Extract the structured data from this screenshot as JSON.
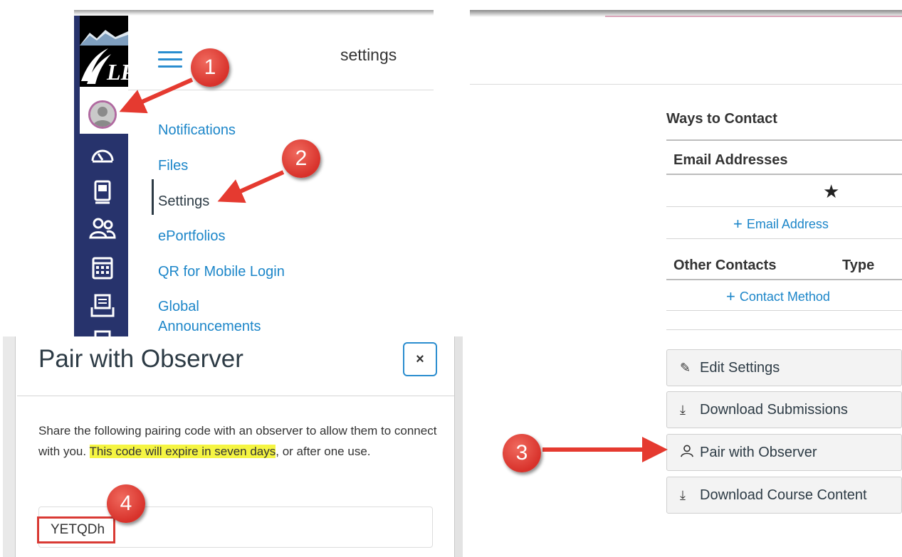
{
  "account_menu": {
    "title": "settings",
    "links": [
      {
        "label": "Notifications"
      },
      {
        "label": "Files"
      },
      {
        "label": "Settings"
      },
      {
        "label": "ePortfolios"
      },
      {
        "label": "QR for Mobile Login"
      },
      {
        "label": "Global"
      },
      {
        "label": "Announcements"
      }
    ],
    "active": "Settings"
  },
  "global_nav": {
    "logo_text": "LP",
    "icons": [
      "dashboard-icon",
      "courses-icon",
      "groups-icon",
      "calendar-icon",
      "inbox-icon",
      "commons-icon"
    ]
  },
  "settings_panel": {
    "ways_to_contact": "Ways to Contact",
    "email_addresses": "Email Addresses",
    "add_email": "Email Address",
    "other_contacts": "Other Contacts",
    "type_col": "Type",
    "add_contact_method": "Contact Method",
    "buttons": {
      "edit_settings": "Edit Settings",
      "download_submissions": "Download Submissions",
      "pair_with_observer": "Pair with Observer",
      "download_course_content": "Download Course Content"
    }
  },
  "modal": {
    "title": "Pair with Observer",
    "close": "×",
    "text_before": "Share the following pairing code with an observer to allow them to connect with you. ",
    "text_highlight": "This code will expire in seven days",
    "text_after": ", or after one use.",
    "pairing_code": "YETQDh"
  },
  "callouts": {
    "one": "1",
    "two": "2",
    "three": "3",
    "four": "4"
  },
  "colors": {
    "nav_bg": "#27336c",
    "link": "#1c86c9",
    "callout_red": "#d8322b",
    "highlight": "#f5f542"
  }
}
